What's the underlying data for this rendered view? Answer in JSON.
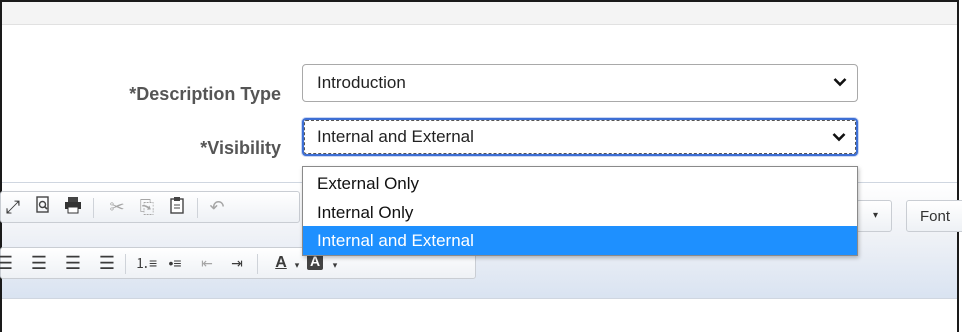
{
  "form": {
    "description_type": {
      "label": "*Description Type",
      "value": "Introduction",
      "icon": "chevron-down-icon"
    },
    "visibility": {
      "label": "*Visibility",
      "value": "Internal and External",
      "icon": "chevron-down-icon",
      "options": [
        "External Only",
        "Internal Only",
        "Internal and External"
      ],
      "highlighted": "Internal and External"
    }
  },
  "editor_toolbar": {
    "row1_icons": [
      "maximize-icon",
      "preview-icon",
      "print-icon",
      "cut-icon",
      "copy-icon",
      "paste-icon",
      "undo-icon"
    ],
    "row2_icons": [
      "align-left-icon",
      "align-center-icon",
      "align-right-icon",
      "justify-icon",
      "numbered-list-icon",
      "bulleted-list-icon",
      "outdent-icon",
      "indent-icon",
      "text-color-icon",
      "background-color-icon"
    ],
    "font_label": "Font",
    "text_color_glyph": "A",
    "bg_color_glyph": "A"
  },
  "colors": {
    "highlight": "#1e90ff",
    "focus_border": "#3e6fd4",
    "label_color": "#555555"
  }
}
